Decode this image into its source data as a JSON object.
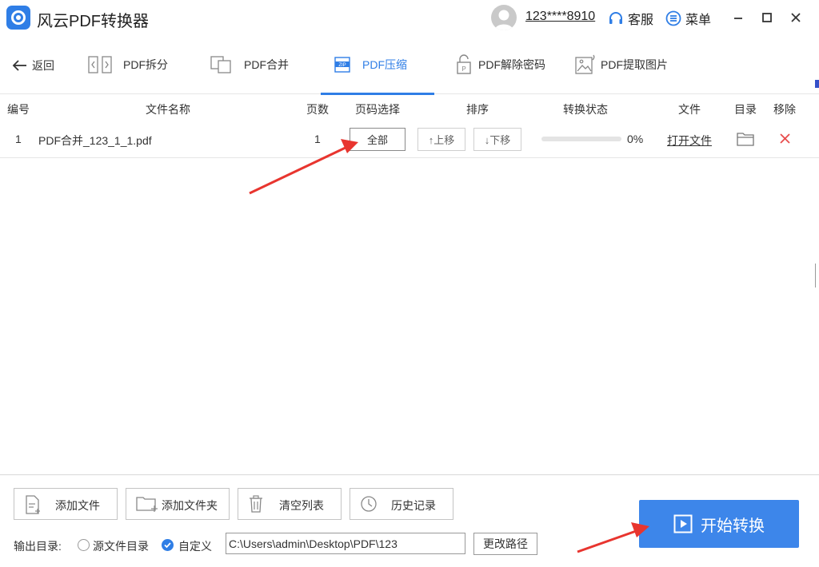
{
  "app": {
    "title": "风云PDF转换器",
    "accent_color": "#2f7ee6"
  },
  "header": {
    "user_name": "123****8910",
    "service_label": "客服",
    "menu_label": "菜单",
    "avatar_icon": "user-avatar-icon"
  },
  "toolbar": {
    "back_label": "返回",
    "tabs": [
      {
        "label": "PDF拆分",
        "icon": "split-icon"
      },
      {
        "label": "PDF合并",
        "icon": "merge-icon"
      },
      {
        "label": "PDF压缩",
        "icon": "zip-icon",
        "active": true
      },
      {
        "label": "PDF解除密码",
        "icon": "unlock-icon"
      },
      {
        "label": "PDF提取图片",
        "icon": "image-extract-icon"
      }
    ]
  },
  "table": {
    "columns": [
      "编号",
      "文件名称",
      "页数",
      "页码选择",
      "排序",
      "转换状态",
      "文件",
      "目录",
      "移除"
    ],
    "rows": [
      {
        "index": "1",
        "filename": "PDF合并_123_1_1.pdf",
        "pages": "1",
        "page_select": "全部",
        "move_up": "↑上移",
        "move_down": "↓下移",
        "progress": 0,
        "progress_text": "0%",
        "open_file": "打开文件"
      }
    ]
  },
  "bottom": {
    "add_file": "添加文件",
    "add_folder": "添加文件夹",
    "clear_list": "清空列表",
    "history": "历史记录",
    "output_label": "输出目录:",
    "option_source": "源文件目录",
    "option_custom": "自定义",
    "selected_option": "custom",
    "output_path": "C:\\Users\\admin\\Desktop\\PDF\\123",
    "change_path": "更改路径",
    "start_label": "开始转换"
  }
}
